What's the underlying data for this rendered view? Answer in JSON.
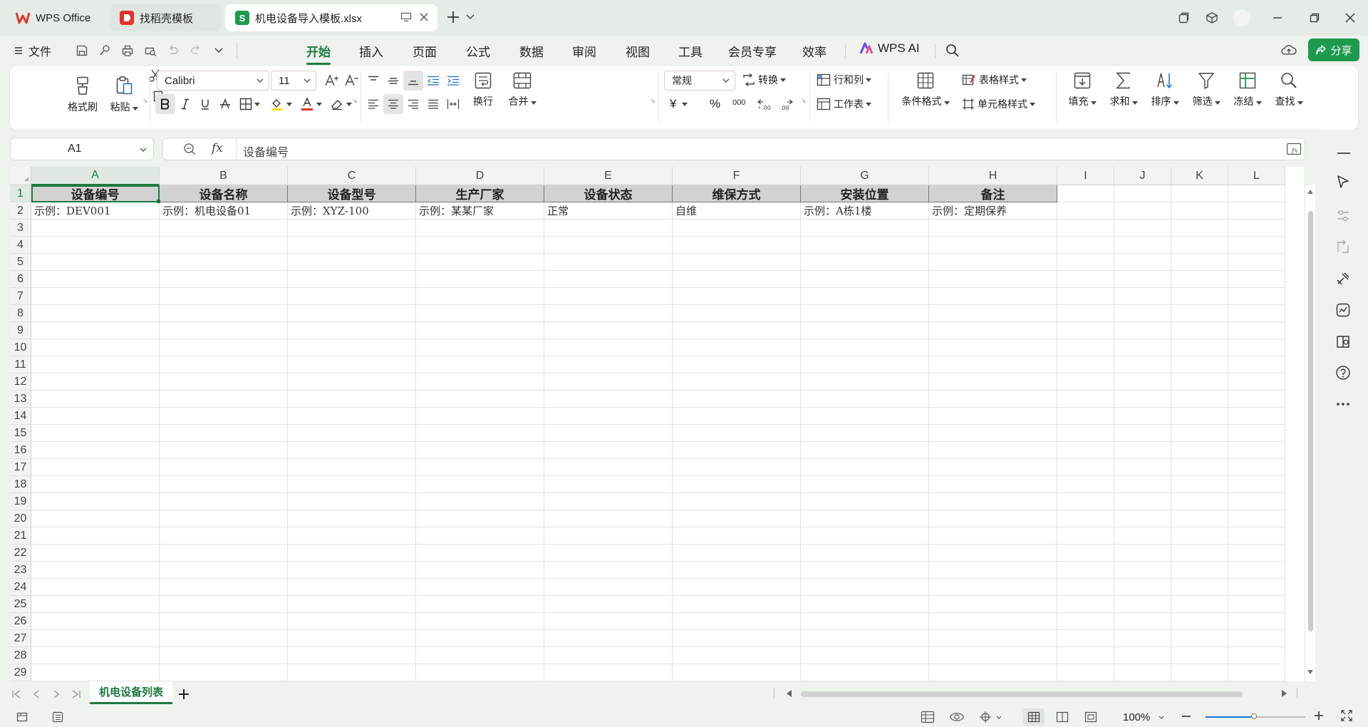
{
  "titlebar": {
    "tabs": [
      {
        "label": "WPS Office",
        "kind": "wps-home"
      },
      {
        "label": "找稻壳模板",
        "kind": "docer"
      },
      {
        "label": "机电设备导入模板.xlsx",
        "kind": "spreadsheet",
        "active": true
      }
    ]
  },
  "menu": {
    "file_label": "文件",
    "tabs": [
      "开始",
      "插入",
      "页面",
      "公式",
      "数据",
      "审阅",
      "视图",
      "工具",
      "会员专享",
      "效率"
    ],
    "active_tab": "开始",
    "wps_ai_label": "WPS AI",
    "share_label": "分享"
  },
  "ribbon": {
    "format_painter": "格式刷",
    "paste": "粘贴",
    "font_name": "Calibri",
    "font_size": "11",
    "wrap_text": "换行",
    "merge": "合并",
    "number_format": "常规",
    "convert": "转换",
    "rows_cols": "行和列",
    "worksheet": "工作表",
    "conditional_format": "条件格式",
    "table_style": "表格样式",
    "cell_style": "单元格样式",
    "fill": "填充",
    "sum": "求和",
    "sort": "排序",
    "filter": "筛选",
    "freeze": "冻结",
    "find": "查找",
    "currency_symbol": "¥",
    "percent_symbol": "%",
    "thousands_symbol": "000"
  },
  "formula_bar": {
    "cell_ref": "A1",
    "content": "设备编号"
  },
  "grid": {
    "columns": [
      "A",
      "B",
      "C",
      "D",
      "E",
      "F",
      "G",
      "H",
      "I",
      "J",
      "K",
      "L"
    ],
    "rows": [
      "1",
      "2",
      "3",
      "4",
      "5",
      "6",
      "7",
      "8",
      "9",
      "10",
      "11",
      "12",
      "13",
      "14",
      "15",
      "16",
      "17",
      "18",
      "19",
      "20",
      "21",
      "22",
      "23",
      "24",
      "25",
      "26",
      "27",
      "28",
      "29"
    ],
    "header_row": [
      "设备编号",
      "设备名称",
      "设备型号",
      "生产厂家",
      "设备状态",
      "维保方式",
      "安装位置",
      "备注"
    ],
    "example_row": [
      "示例：DEV001",
      "示例：机电设备01",
      "示例：XYZ-100",
      "示例：某某厂家",
      "正常",
      "自维",
      "示例：A栋1楼",
      "示例：定期保养"
    ]
  },
  "sheets": {
    "tabs": [
      "机电设备列表"
    ],
    "active": "机电设备列表"
  },
  "status": {
    "zoom": "100%"
  },
  "colors": {
    "accent": "#1d7a3e",
    "wps_red": "#e3322b",
    "header_fill": "#d2d2d2"
  }
}
